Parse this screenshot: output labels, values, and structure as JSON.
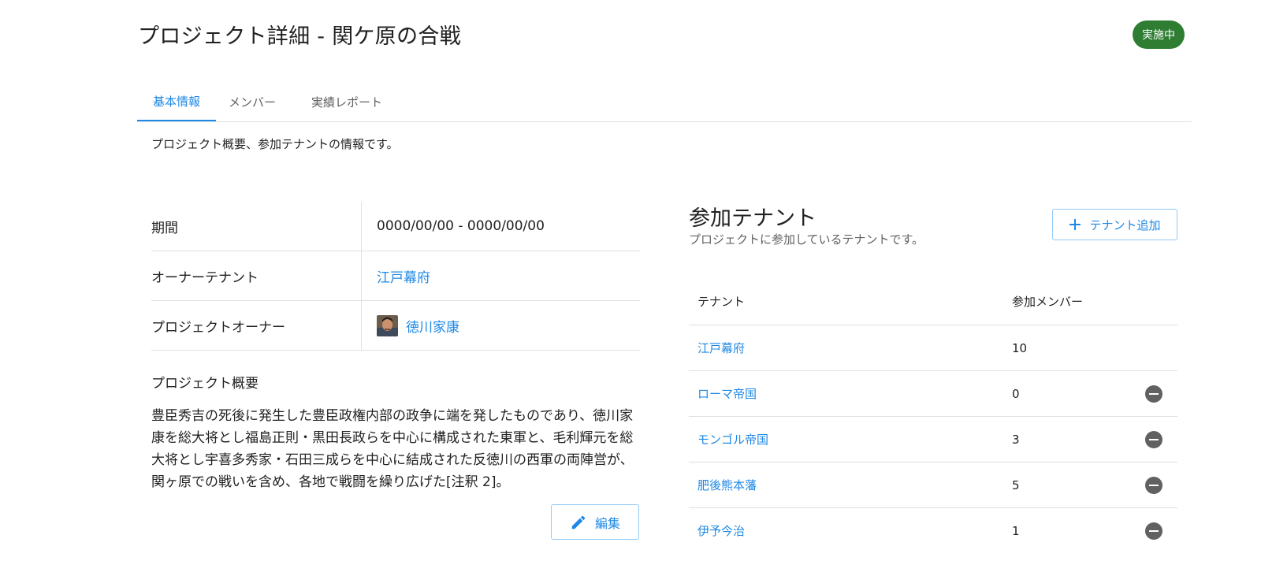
{
  "header": {
    "title": "プロジェクト詳細 - 関ケ原の合戦",
    "status": "実施中",
    "status_color": "#2e7d32"
  },
  "tabs": [
    {
      "label": "基本情報",
      "active": true
    },
    {
      "label": "メンバー",
      "active": false
    },
    {
      "label": "実績レポート",
      "active": false
    }
  ],
  "tab_description": "プロジェクト概要、参加テナントの情報です。",
  "info": {
    "period_label": "期間",
    "period_value": "0000/00/00 - 0000/00/00",
    "owner_tenant_label": "オーナーテナント",
    "owner_tenant_value": "江戸幕府",
    "project_owner_label": "プロジェクトオーナー",
    "project_owner_value": "徳川家康"
  },
  "summary": {
    "heading": "プロジェクト概要",
    "body": "豊臣秀吉の死後に発生した豊臣政権内部の政争に端を発したものであり、徳川家康を総大将とし福島正則・黒田長政らを中心に構成された東軍と、毛利輝元を総大将とし宇喜多秀家・石田三成らを中心に結成された反徳川の西軍の両陣営が、関ヶ原での戦いを含め、各地で戦闘を繰り広げた[注釈 2]。",
    "edit_label": "編集"
  },
  "tenants": {
    "title": "参加テナント",
    "subtitle": "プロジェクトに参加しているテナントです。",
    "add_label": "テナント追加",
    "columns": {
      "name": "テナント",
      "members": "参加メンバー"
    },
    "rows": [
      {
        "name": "江戸幕府",
        "members": "10",
        "removable": false
      },
      {
        "name": "ローマ帝国",
        "members": "0",
        "removable": true
      },
      {
        "name": "モンゴル帝国",
        "members": "3",
        "removable": true
      },
      {
        "name": "肥後熊本藩",
        "members": "5",
        "removable": true
      },
      {
        "name": "伊予今治",
        "members": "1",
        "removable": true
      }
    ]
  },
  "accent_color": "#1e88e5"
}
